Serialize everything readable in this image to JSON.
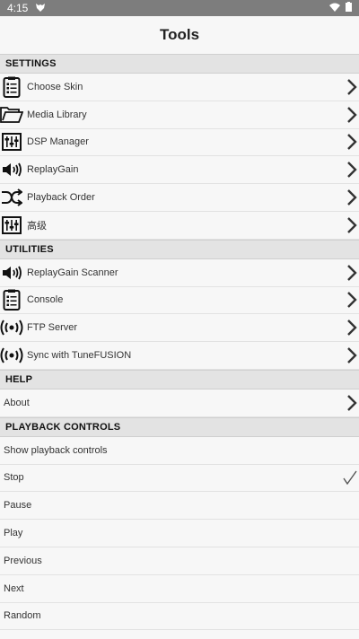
{
  "status": {
    "time": "4:15"
  },
  "title": "Tools",
  "sections": {
    "settings": {
      "header": "SETTINGS",
      "items": [
        {
          "label": "Choose Skin",
          "icon": "clipboard-list-icon"
        },
        {
          "label": "Media Library",
          "icon": "folder-icon"
        },
        {
          "label": "DSP Manager",
          "icon": "equalizer-icon"
        },
        {
          "label": "ReplayGain",
          "icon": "speaker-icon"
        },
        {
          "label": "Playback Order",
          "icon": "shuffle-icon"
        },
        {
          "label": "高级",
          "icon": "equalizer-icon"
        }
      ]
    },
    "utilities": {
      "header": "UTILITIES",
      "items": [
        {
          "label": "ReplayGain Scanner",
          "icon": "speaker-icon"
        },
        {
          "label": "Console",
          "icon": "clipboard-list-icon"
        },
        {
          "label": "FTP Server",
          "icon": "broadcast-icon"
        },
        {
          "label": "Sync with TuneFUSION",
          "icon": "broadcast-icon"
        }
      ]
    },
    "help": {
      "header": "HELP",
      "items": [
        {
          "label": "About"
        }
      ]
    },
    "playback": {
      "header": "PLAYBACK CONTROLS",
      "items": [
        {
          "label": "Show playback controls",
          "checked": false
        },
        {
          "label": "Stop",
          "checked": true
        },
        {
          "label": "Pause",
          "checked": false
        },
        {
          "label": "Play",
          "checked": false
        },
        {
          "label": "Previous",
          "checked": false
        },
        {
          "label": "Next",
          "checked": false
        },
        {
          "label": "Random",
          "checked": false
        }
      ]
    }
  }
}
